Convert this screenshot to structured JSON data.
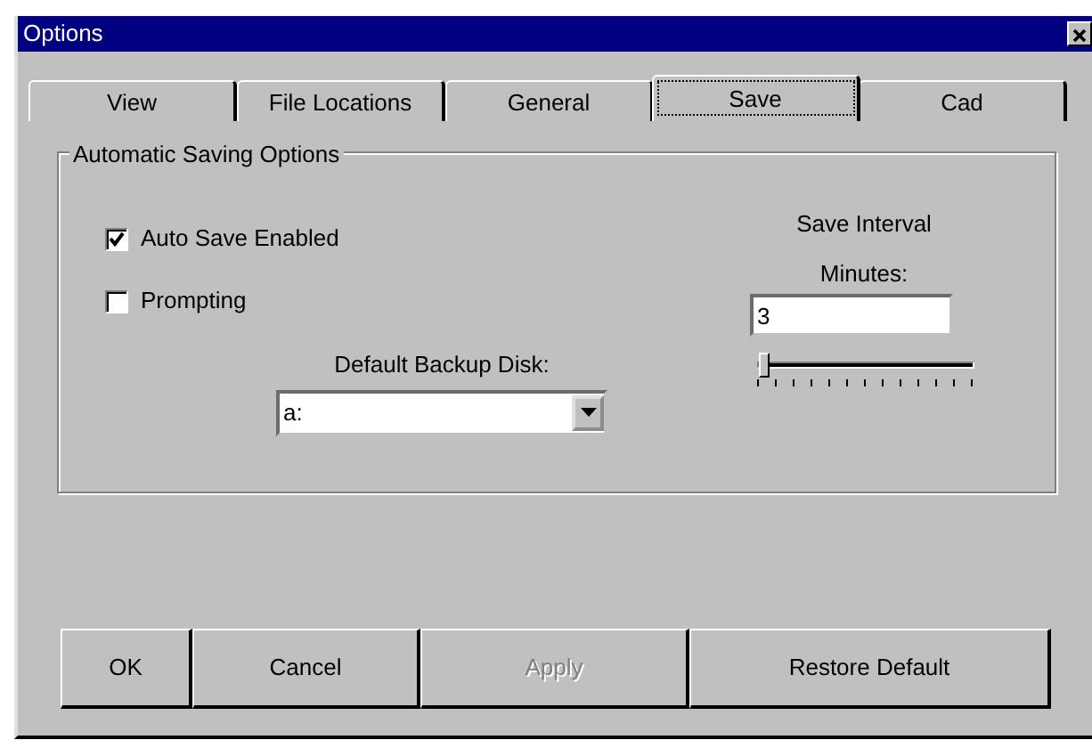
{
  "window": {
    "title": "Options"
  },
  "tabs": [
    {
      "label": "View",
      "selected": false
    },
    {
      "label": "File Locations",
      "selected": false
    },
    {
      "label": "General",
      "selected": false
    },
    {
      "label": "Save",
      "selected": true
    },
    {
      "label": "Cad",
      "selected": false
    }
  ],
  "group": {
    "title": "Automatic Saving Options",
    "checkboxes": [
      {
        "label": "Auto Save Enabled",
        "checked": true
      },
      {
        "label": "Prompting",
        "checked": false
      }
    ],
    "backup_disk": {
      "label": "Default Backup Disk:",
      "value": "a:"
    },
    "save_interval": {
      "title": "Save Interval",
      "label": "Minutes:",
      "value": "3",
      "level": 0.0
    }
  },
  "buttons": [
    {
      "label": "OK",
      "disabled": false
    },
    {
      "label": "Cancel",
      "disabled": false
    },
    {
      "label": "Apply",
      "disabled": true
    },
    {
      "label": "Restore Default",
      "disabled": false
    }
  ]
}
